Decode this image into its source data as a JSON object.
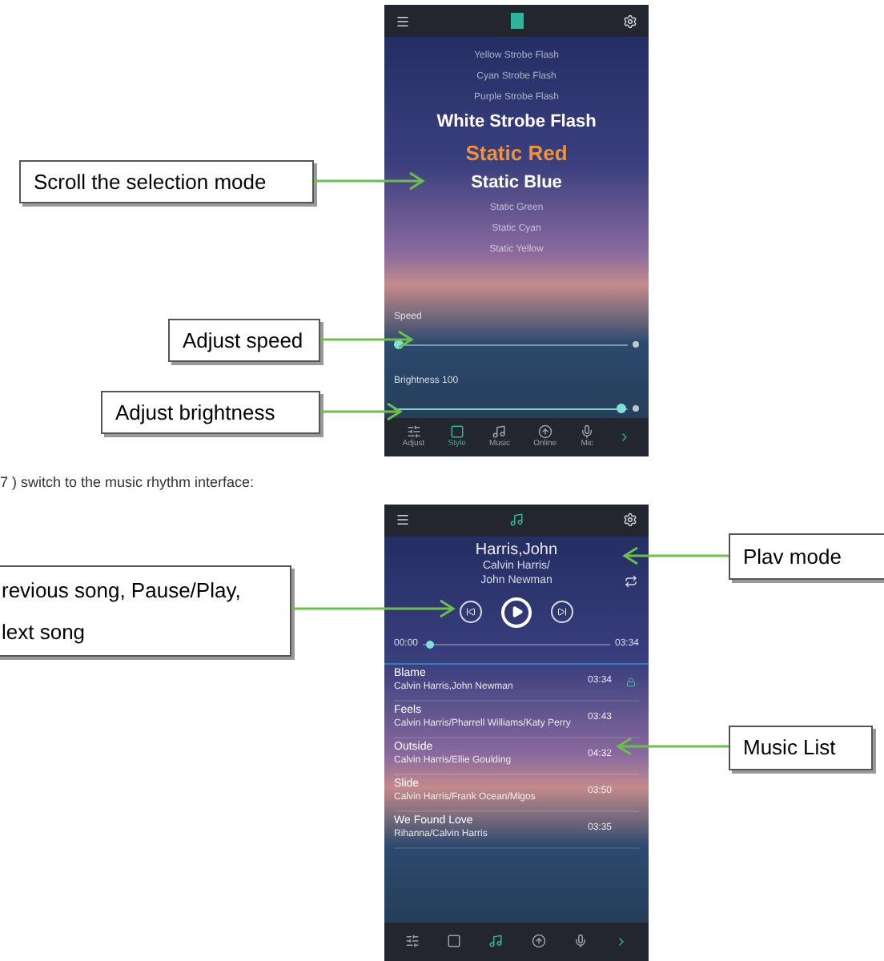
{
  "style_screen": {
    "modes": [
      {
        "label": "Yellow Strobe Flash",
        "selected": false
      },
      {
        "label": "Cyan Strobe Flash",
        "selected": false
      },
      {
        "label": "Purple Strobe Flash",
        "selected": false
      },
      {
        "label": "White Strobe Flash",
        "selected": false
      },
      {
        "label": "Static Red",
        "selected": true
      },
      {
        "label": "Static Blue",
        "selected": false
      },
      {
        "label": "Static Green",
        "selected": false
      },
      {
        "label": "Static Cyan",
        "selected": false
      },
      {
        "label": "Static Yellow",
        "selected": false
      }
    ],
    "sliders": [
      {
        "label": "Speed",
        "level": 0.02
      },
      {
        "label": "Brightness 100",
        "level": 0.97
      }
    ],
    "tabs": [
      {
        "label": "Adjust",
        "selected": false
      },
      {
        "label": "Style",
        "selected": true
      },
      {
        "label": "Music",
        "selected": false
      },
      {
        "label": "Online",
        "selected": false
      },
      {
        "label": "Mic",
        "selected": false
      }
    ]
  },
  "caption": "7 ) switch to the music rhythm interface:",
  "music_screen": {
    "title": "Harris,John",
    "artist": "Calvin Harris/\nJohn Newman",
    "elapsed": "00:00",
    "duration": "03:34",
    "level": 0.03,
    "songs": [
      {
        "title": "Blame",
        "artist": "Calvin Harris,John Newman",
        "time": "03:34",
        "selected": true
      },
      {
        "title": "Feels",
        "artist": "Calvin Harris/Pharrell Williams/Katy Perry",
        "time": "03:43",
        "selected": false
      },
      {
        "title": "Outside",
        "artist": "Calvin Harris/Ellie Goulding",
        "time": "04:32",
        "selected": false
      },
      {
        "title": "Slide",
        "artist": "Calvin Harris/Frank Ocean/Migos",
        "time": "03:50",
        "selected": false
      },
      {
        "title": "We Found Love",
        "artist": "Rihanna/Calvin Harris",
        "time": "03:35",
        "selected": false
      }
    ],
    "tabs": [
      {
        "selected": false
      },
      {
        "selected": false
      },
      {
        "selected": true
      },
      {
        "selected": false
      },
      {
        "selected": false
      }
    ]
  },
  "callouts": [
    {
      "text": "Scroll the selection mode"
    },
    {
      "text": "Adjust speed"
    },
    {
      "text": "Adjust brightness"
    },
    {
      "text": "revious song, Pause/Play,\nlext song"
    },
    {
      "text": "Plav mode"
    },
    {
      "text": "Music List"
    }
  ]
}
